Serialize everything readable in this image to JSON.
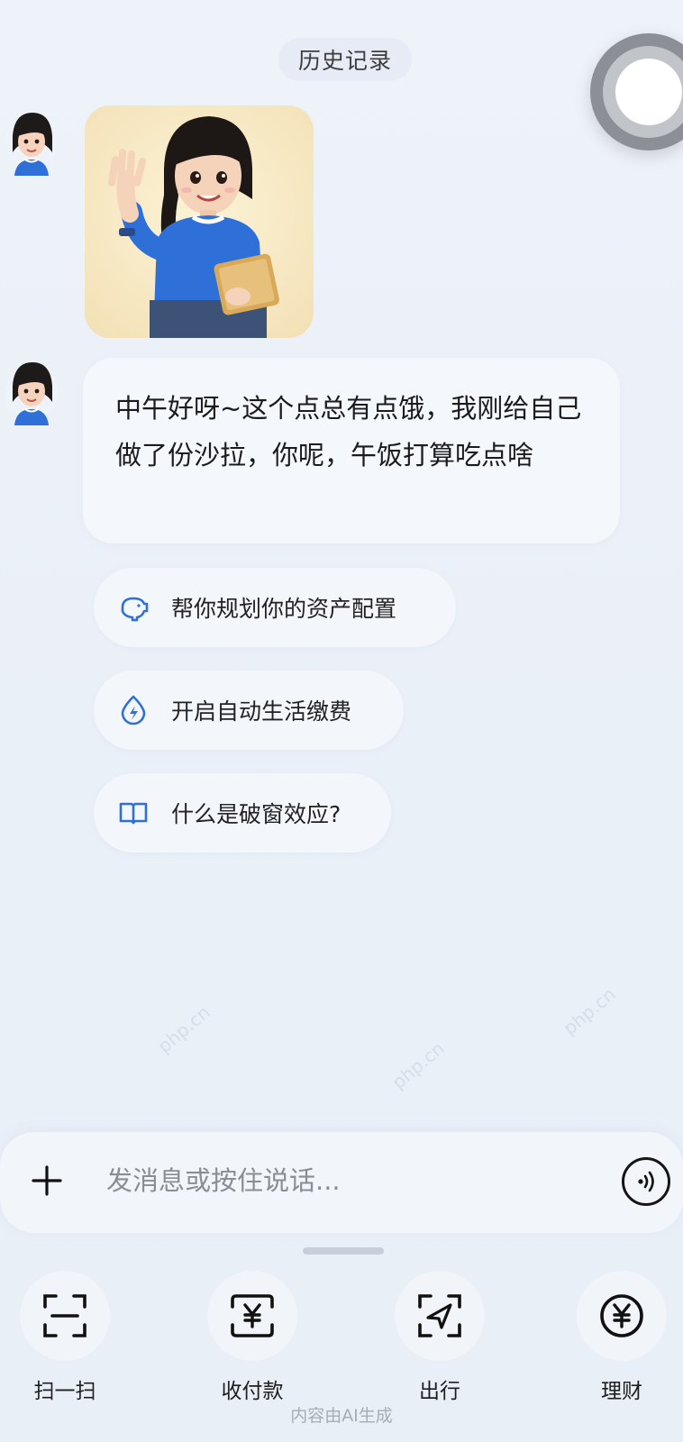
{
  "header": {
    "history_label": "历史记录"
  },
  "chat": {
    "greeting_image_alt": "waving-assistant",
    "message": "中午好呀~这个点总有点饿，我刚给自己做了份沙拉，你呢，午饭打算吃点啥",
    "suggestions": [
      {
        "label": "帮你规划你的资产配置",
        "icon": "piggy-bank-icon"
      },
      {
        "label": "开启自动生活缴费",
        "icon": "lightning-drop-icon"
      },
      {
        "label": "什么是破窗效应?",
        "icon": "book-icon"
      }
    ]
  },
  "composer": {
    "placeholder": "发消息或按住说话...",
    "plus_icon": "plus-icon",
    "voice_icon": "voice-icon"
  },
  "shortcuts": [
    {
      "label": "扫一扫",
      "icon": "scan-icon"
    },
    {
      "label": "收付款",
      "icon": "payment-icon"
    },
    {
      "label": "出行",
      "icon": "travel-icon"
    },
    {
      "label": "理财",
      "icon": "wealth-icon"
    }
  ],
  "footer": {
    "note": "内容由AI生成"
  },
  "watermark": "php.cn",
  "colors": {
    "accent_blue": "#2f6fd8",
    "bubble": "#f4f7fc",
    "background": "#eaf0f8"
  }
}
